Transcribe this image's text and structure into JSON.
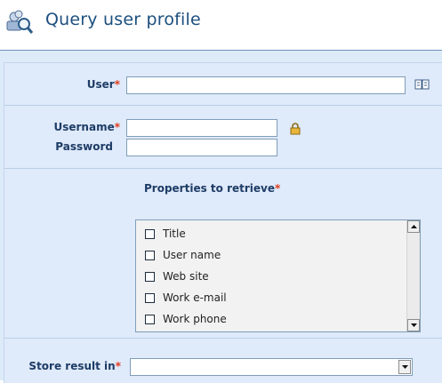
{
  "header": {
    "title": "Query user profile",
    "icon": "user-search-icon"
  },
  "form": {
    "user_label": "User",
    "username_label": "Username",
    "password_label": "Password",
    "properties_label": "Properties to retrieve",
    "store_label": "Store result in",
    "required_marker": "*",
    "user_value": "",
    "username_value": "",
    "password_value": "",
    "store_value": ""
  },
  "properties": [
    {
      "label": "Title",
      "checked": false
    },
    {
      "label": "User name",
      "checked": false
    },
    {
      "label": "Web site",
      "checked": false
    },
    {
      "label": "Work e-mail",
      "checked": false
    },
    {
      "label": "Work phone",
      "checked": false
    }
  ],
  "colors": {
    "title": "#1d4f7e",
    "label": "#1d3c66",
    "required": "#e23b1a",
    "panel_bg": "#dfeafa"
  }
}
